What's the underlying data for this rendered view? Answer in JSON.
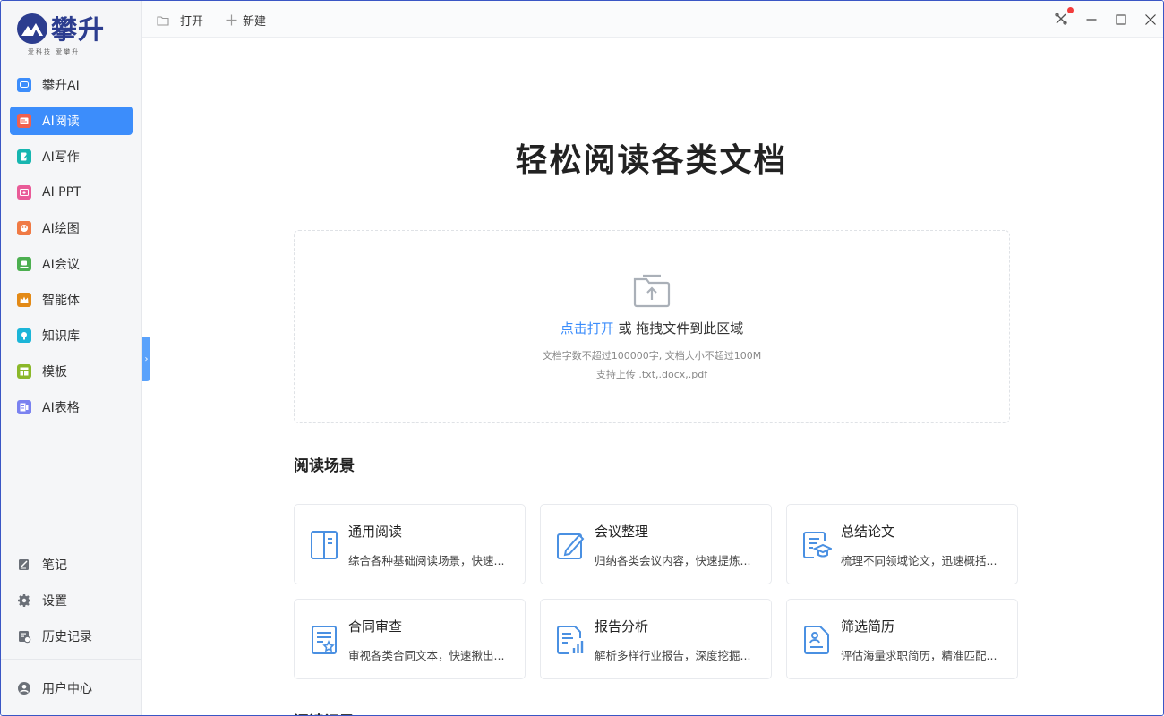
{
  "app": {
    "logo_title": "攀升",
    "logo_subtitle": "爱科技  爱攀升",
    "brand_color": "#2c3d8f",
    "accent": "#3c8dfb"
  },
  "sidebar": {
    "items": [
      {
        "label": "攀升AI",
        "icon": "chat-icon",
        "color": "#3c8dfb"
      },
      {
        "label": "AI阅读",
        "icon": "reader-icon",
        "color": "#f0604d",
        "active": true
      },
      {
        "label": "AI写作",
        "icon": "pen-icon",
        "color": "#17b6b0"
      },
      {
        "label": "AI PPT",
        "icon": "ppt-icon",
        "color": "#e95b98"
      },
      {
        "label": "AI绘图",
        "icon": "palette-icon",
        "color": "#f07a45"
      },
      {
        "label": "AI会议",
        "icon": "meeting-icon",
        "color": "#4caf50"
      },
      {
        "label": "智能体",
        "icon": "crown-icon",
        "color": "#e38a17"
      },
      {
        "label": "知识库",
        "icon": "knowledge-icon",
        "color": "#1bb5d8"
      },
      {
        "label": "模板",
        "icon": "template-icon",
        "color": "#8bb82a"
      },
      {
        "label": "AI表格",
        "icon": "table-icon",
        "color": "#7a82f0"
      }
    ],
    "bottom_items": [
      {
        "label": "笔记",
        "icon": "note-icon"
      },
      {
        "label": "设置",
        "icon": "gear-icon"
      },
      {
        "label": "历史记录",
        "icon": "history-icon"
      }
    ],
    "user_center": "用户中心"
  },
  "toolbar": {
    "open_label": "打开",
    "new_label": "新建"
  },
  "main": {
    "hero_title": "轻松阅读各类文档",
    "dropzone": {
      "link_text": "点击打开",
      "rest_text": " 或 拖拽文件到此区域",
      "hint1": "文档字数不超过100000字, 文档大小不超过100M",
      "hint2": "支持上传 .txt,.docx,.pdf"
    },
    "scenarios_title": "阅读场景",
    "scenarios": [
      {
        "title": "通用阅读",
        "desc": "综合各种基础阅读场景，快速...",
        "icon": "book-icon"
      },
      {
        "title": "会议整理",
        "desc": "归纳各类会议内容，快速提炼...",
        "icon": "edit-doc-icon"
      },
      {
        "title": "总结论文",
        "desc": "梳理不同领域论文，迅速概括...",
        "icon": "graduation-doc-icon"
      },
      {
        "title": "合同审查",
        "desc": "审视各类合同文本，快速揪出...",
        "icon": "contract-icon"
      },
      {
        "title": "报告分析",
        "desc": "解析多样行业报告，深度挖掘...",
        "icon": "report-chart-icon"
      },
      {
        "title": "筛选简历",
        "desc": "评估海量求职简历，精准匹配...",
        "icon": "resume-icon"
      }
    ],
    "next_section_title": "阅读记录"
  }
}
